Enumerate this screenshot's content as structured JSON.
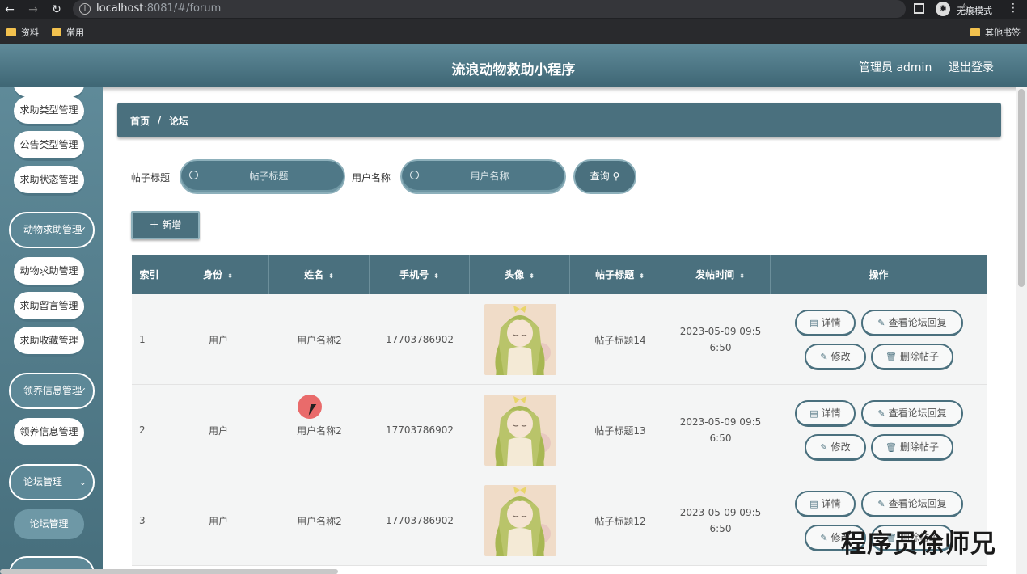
{
  "browser": {
    "url_host": "localhost",
    "url_rest": ":8081/#/forum",
    "incognito_label": "无痕模式",
    "bookmarks": [
      "资料",
      "常用"
    ],
    "other_bookmarks": "其他书签"
  },
  "app": {
    "title": "流浪动物救助小程序",
    "admin": "管理员 admin",
    "logout": "退出登录"
  },
  "sidebar": {
    "items": [
      {
        "label": "求助类型管理",
        "type": "item"
      },
      {
        "label": "公告类型管理",
        "type": "item"
      },
      {
        "label": "求助状态管理",
        "type": "item"
      },
      {
        "label": "动物求助管理",
        "type": "group"
      },
      {
        "label": "动物求助管理",
        "type": "item"
      },
      {
        "label": "求助留言管理",
        "type": "item"
      },
      {
        "label": "求助收藏管理",
        "type": "item"
      },
      {
        "label": "领养信息管理",
        "type": "group"
      },
      {
        "label": "领养信息管理",
        "type": "item"
      },
      {
        "label": "论坛管理",
        "type": "group"
      },
      {
        "label": "论坛管理",
        "type": "active"
      }
    ]
  },
  "breadcrumb": {
    "home": "首页",
    "separator": "/",
    "current": "论坛"
  },
  "search": {
    "title_label": "帖子标题",
    "title_placeholder": "帖子标题",
    "user_label": "用户名称",
    "user_placeholder": "用户名称",
    "query_button": "查询"
  },
  "add_button": "新增",
  "table": {
    "headers": [
      "索引",
      "身份",
      "姓名",
      "手机号",
      "头像",
      "帖子标题",
      "发帖时间",
      "操作"
    ],
    "rows": [
      {
        "index": "1",
        "identity": "用户",
        "name": "用户名称2",
        "phone": "17703786902",
        "post_title": "帖子标题14",
        "time_line1": "2023-05-09 09:5",
        "time_line2": "6:50"
      },
      {
        "index": "2",
        "identity": "用户",
        "name": "用户名称2",
        "phone": "17703786902",
        "post_title": "帖子标题13",
        "time_line1": "2023-05-09 09:5",
        "time_line2": "6:50"
      },
      {
        "index": "3",
        "identity": "用户",
        "name": "用户名称2",
        "phone": "17703786902",
        "post_title": "帖子标题12",
        "time_line1": "2023-05-09 09:5",
        "time_line2": "6:50"
      }
    ],
    "actions": {
      "detail": "详情",
      "view_replies": "查看论坛回复",
      "edit": "修改",
      "delete": "删除帖子"
    }
  },
  "watermark": "程序员徐师兄",
  "colors": {
    "primary": "#4a707e",
    "header_gradient_top": "#5f8a99",
    "border_light": "#8db0bb"
  }
}
